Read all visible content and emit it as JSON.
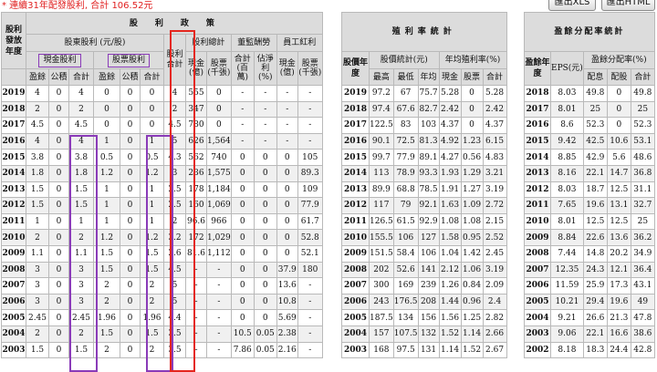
{
  "top_note": "* 連續31年配發股利, 合計 106.52元",
  "buttons": {
    "xls": "匯出XLS",
    "html": "匯出HTML"
  },
  "left": {
    "title": "股　利　政　策",
    "year_header": "股利發放年度",
    "dividend_header": "股東股利 (元/股)",
    "cash_group": "現金股利",
    "stock_group": "股票股利",
    "col_earnings": "盈餘",
    "col_reserve": "公積",
    "col_sum": "合計",
    "total_header": "股利合計",
    "amount_header": "股利總計",
    "amount_cash": "現金(億)",
    "amount_stock": "股票(千張)",
    "director_header": "董監酬勞",
    "director_sum": "合計(百萬)",
    "director_pct": "佔淨利(%)",
    "employee_header": "員工紅利",
    "employee_cash": "現金(億)",
    "employee_stock": "股票(千張)",
    "rows": [
      [
        "2019",
        "4",
        "0",
        "4",
        "0",
        "0",
        "0",
        "4",
        "555",
        "0",
        "-",
        "-",
        "-",
        "-"
      ],
      [
        "2018",
        "2",
        "0",
        "2",
        "0",
        "0",
        "0",
        "2",
        "347",
        "0",
        "-",
        "-",
        "-",
        "-"
      ],
      [
        "2017",
        "4.5",
        "0",
        "4.5",
        "0",
        "0",
        "0",
        "4.5",
        "780",
        "0",
        "-",
        "-",
        "-",
        "-"
      ],
      [
        "2016",
        "4",
        "0",
        "4",
        "1",
        "0",
        "1",
        "5",
        "626",
        "1,564",
        "-",
        "-",
        "-",
        "-"
      ],
      [
        "2015",
        "3.8",
        "0",
        "3.8",
        "0.5",
        "0",
        "0.5",
        "4.3",
        "562",
        "740",
        "0",
        "0",
        "0",
        "105"
      ],
      [
        "2014",
        "1.8",
        "0",
        "1.8",
        "1.2",
        "0",
        "1.2",
        "3",
        "236",
        "1,575",
        "0",
        "0",
        "0",
        "89.3"
      ],
      [
        "2013",
        "1.5",
        "0",
        "1.5",
        "1",
        "0",
        "1",
        "2.5",
        "178",
        "1,184",
        "0",
        "0",
        "0",
        "109"
      ],
      [
        "2012",
        "1.5",
        "0",
        "1.5",
        "1",
        "0",
        "1",
        "2.5",
        "160",
        "1,069",
        "0",
        "0",
        "0",
        "77.9"
      ],
      [
        "2011",
        "1",
        "0",
        "1",
        "1",
        "0",
        "1",
        "2",
        "96.6",
        "966",
        "0",
        "0",
        "0",
        "61.7"
      ],
      [
        "2010",
        "2",
        "0",
        "2",
        "1.2",
        "0",
        "1.2",
        "3.2",
        "172",
        "1,029",
        "0",
        "0",
        "0",
        "52.8"
      ],
      [
        "2009",
        "1.1",
        "0",
        "1.1",
        "1.5",
        "0",
        "1.5",
        "2.6",
        "81.6",
        "1,112",
        "0",
        "0",
        "0",
        "52.1"
      ],
      [
        "2008",
        "3",
        "0",
        "3",
        "1.5",
        "0",
        "1.5",
        "4.5",
        "-",
        "-",
        "0",
        "0",
        "37.9",
        "180"
      ],
      [
        "2007",
        "3",
        "0",
        "3",
        "2",
        "0",
        "2",
        "5",
        "-",
        "-",
        "0",
        "0",
        "13.6",
        "-"
      ],
      [
        "2006",
        "3",
        "0",
        "3",
        "2",
        "0",
        "2",
        "5",
        "-",
        "-",
        "0",
        "0",
        "10.8",
        "-"
      ],
      [
        "2005",
        "2.45",
        "0",
        "2.45",
        "1.96",
        "0",
        "1.96",
        "4.4",
        "-",
        "-",
        "0",
        "0",
        "5.69",
        "-"
      ],
      [
        "2004",
        "2",
        "0",
        "2",
        "1.5",
        "0",
        "1.5",
        "3.5",
        "-",
        "-",
        "10.5",
        "0.05",
        "2.38",
        "-"
      ],
      [
        "2003",
        "1.5",
        "0",
        "1.5",
        "2",
        "0",
        "2",
        "3.5",
        "-",
        "-",
        "7.86",
        "0.05",
        "2.16",
        "-"
      ]
    ]
  },
  "mid": {
    "title": "殖利率統計",
    "year_header": "股價年度",
    "price_header": "股價統計(元)",
    "price_high": "最高",
    "price_low": "最低",
    "price_avg": "年均",
    "yield_header": "年均殖利率(%)",
    "yield_cash": "現金",
    "yield_stock": "股票",
    "yield_sum": "合計",
    "rows": [
      [
        "2019",
        "97.2",
        "67",
        "75.7",
        "5.28",
        "0",
        "5.28"
      ],
      [
        "2018",
        "97.4",
        "67.6",
        "82.7",
        "2.42",
        "0",
        "2.42"
      ],
      [
        "2017",
        "122.5",
        "83",
        "103",
        "4.37",
        "0",
        "4.37"
      ],
      [
        "2016",
        "90.1",
        "72.5",
        "81.3",
        "4.92",
        "1.23",
        "6.15"
      ],
      [
        "2015",
        "99.7",
        "77.9",
        "89.1",
        "4.27",
        "0.56",
        "4.83"
      ],
      [
        "2014",
        "113",
        "78.9",
        "93.3",
        "1.93",
        "1.29",
        "3.21"
      ],
      [
        "2013",
        "89.9",
        "68.8",
        "78.5",
        "1.91",
        "1.27",
        "3.19"
      ],
      [
        "2012",
        "117",
        "79",
        "92.1",
        "1.63",
        "1.09",
        "2.72"
      ],
      [
        "2011",
        "126.5",
        "61.5",
        "92.9",
        "1.08",
        "1.08",
        "2.15"
      ],
      [
        "2010",
        "155.5",
        "106",
        "127",
        "1.58",
        "0.95",
        "2.52"
      ],
      [
        "2009",
        "151.5",
        "58.4",
        "106",
        "1.04",
        "1.42",
        "2.45"
      ],
      [
        "2008",
        "202",
        "52.6",
        "141",
        "2.12",
        "1.06",
        "3.19"
      ],
      [
        "2007",
        "300",
        "169",
        "239",
        "1.26",
        "0.84",
        "2.09"
      ],
      [
        "2006",
        "243",
        "176.5",
        "208",
        "1.44",
        "0.96",
        "2.4"
      ],
      [
        "2005",
        "187.5",
        "134",
        "156",
        "1.56",
        "1.25",
        "2.82"
      ],
      [
        "2004",
        "157",
        "107.5",
        "132",
        "1.52",
        "1.14",
        "2.66"
      ],
      [
        "2003",
        "168",
        "97.5",
        "131",
        "1.14",
        "1.52",
        "2.67"
      ]
    ]
  },
  "right": {
    "title": "盈餘分配率統計",
    "year_header": "盈餘年度",
    "eps_header": "EPS(元)",
    "payout_header": "盈餘分配率(%)",
    "payout_div": "配息",
    "payout_stock": "配股",
    "payout_sum": "合計",
    "rows": [
      [
        "2018",
        "8.03",
        "49.8",
        "0",
        "49.8"
      ],
      [
        "2017",
        "8.01",
        "25",
        "0",
        "25"
      ],
      [
        "2016",
        "8.6",
        "52.3",
        "0",
        "52.3"
      ],
      [
        "2015",
        "9.42",
        "42.5",
        "10.6",
        "53.1"
      ],
      [
        "2014",
        "8.85",
        "42.9",
        "5.6",
        "48.6"
      ],
      [
        "2013",
        "8.16",
        "22.1",
        "14.7",
        "36.8"
      ],
      [
        "2012",
        "8.03",
        "18.7",
        "12.5",
        "31.1"
      ],
      [
        "2011",
        "7.65",
        "19.6",
        "13.1",
        "32.7"
      ],
      [
        "2010",
        "8.01",
        "12.5",
        "12.5",
        "25"
      ],
      [
        "2009",
        "8.84",
        "22.6",
        "13.6",
        "36.2"
      ],
      [
        "2008",
        "7.44",
        "14.8",
        "20.2",
        "34.9"
      ],
      [
        "2007",
        "12.35",
        "24.3",
        "12.1",
        "36.4"
      ],
      [
        "2006",
        "11.59",
        "25.9",
        "17.3",
        "43.1"
      ],
      [
        "2005",
        "10.21",
        "29.4",
        "19.6",
        "49"
      ],
      [
        "2004",
        "9.21",
        "26.6",
        "21.3",
        "47.8"
      ],
      [
        "2003",
        "9.06",
        "22.1",
        "16.6",
        "38.6"
      ],
      [
        "2002",
        "8.18",
        "18.3",
        "24.4",
        "42.8"
      ]
    ]
  }
}
